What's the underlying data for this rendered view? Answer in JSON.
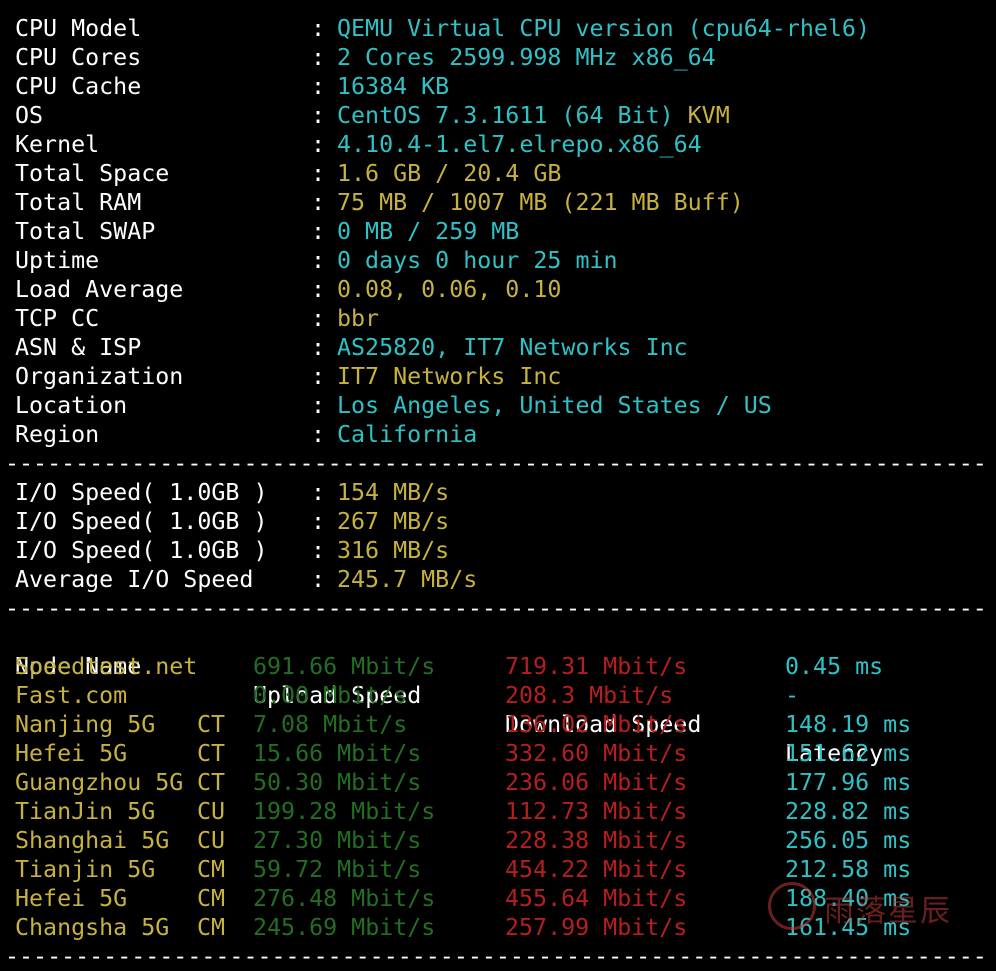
{
  "sysinfo": [
    {
      "key": "CPU Model",
      "value": "QEMU Virtual CPU version (cpu64-rhel6)",
      "value_tail": "",
      "color": "cy"
    },
    {
      "key": "CPU Cores",
      "value": "2 Cores 2599.998 MHz x86_64",
      "value_tail": "",
      "color": "cy"
    },
    {
      "key": "CPU Cache",
      "value": "16384 KB",
      "value_tail": "",
      "color": "cy"
    },
    {
      "key": "OS",
      "value": "CentOS 7.3.1611 (64 Bit)",
      "value_tail": " KVM",
      "color": "cy"
    },
    {
      "key": "Kernel",
      "value": "4.10.4-1.el7.elrepo.x86_64",
      "value_tail": "",
      "color": "cy"
    },
    {
      "key": "Total Space",
      "value": "1.6 GB / 20.4 GB",
      "value_tail": "",
      "color": "yl"
    },
    {
      "key": "Total RAM",
      "value": "75 MB / 1007 MB (221 MB Buff)",
      "value_tail": "",
      "color": "yl"
    },
    {
      "key": "Total SWAP",
      "value": "0 MB / 259 MB",
      "value_tail": "",
      "color": "cy"
    },
    {
      "key": "Uptime",
      "value": "0 days 0 hour 25 min",
      "value_tail": "",
      "color": "cy"
    },
    {
      "key": "Load Average",
      "value": "0.08, 0.06, 0.10",
      "value_tail": "",
      "color": "yl"
    },
    {
      "key": "TCP CC",
      "value": "bbr",
      "value_tail": "",
      "color": "yl"
    },
    {
      "key": "ASN & ISP",
      "value": "AS25820, IT7 Networks Inc",
      "value_tail": "",
      "color": "cy"
    },
    {
      "key": "Organization",
      "value": "IT7 Networks Inc",
      "value_tail": "",
      "color": "yl"
    },
    {
      "key": "Location",
      "value": "Los Angeles, United States / US",
      "value_tail": "",
      "color": "cy"
    },
    {
      "key": "Region",
      "value": "California",
      "value_tail": "",
      "color": "cy"
    }
  ],
  "separator_char": ":",
  "dash_line": "------------------------------------------------------------------------",
  "io": [
    {
      "key": "I/O Speed( 1.0GB )",
      "value": "154 MB/s"
    },
    {
      "key": "I/O Speed( 1.0GB )",
      "value": "267 MB/s"
    },
    {
      "key": "I/O Speed( 1.0GB )",
      "value": "316 MB/s"
    },
    {
      "key": "Average I/O Speed",
      "value": "245.7 MB/s"
    }
  ],
  "speed_headers": {
    "node": "Node Name",
    "upload": "Upload Speed",
    "download": "Download Speed",
    "latency": "Latency"
  },
  "speed_rows": [
    {
      "node": "Speedtest.net",
      "tag": "",
      "upload": "691.66 Mbit/s",
      "download": "719.31 Mbit/s",
      "latency": "0.45 ms"
    },
    {
      "node": "Fast.com",
      "tag": "",
      "upload": "0.00 Mbit/s",
      "download": "208.3 Mbit/s",
      "latency": "-"
    },
    {
      "node": "Nanjing 5G",
      "tag": "CT",
      "upload": "7.08 Mbit/s",
      "download": "136.02 Mbit/s",
      "latency": "148.19 ms"
    },
    {
      "node": "Hefei 5G",
      "tag": "CT",
      "upload": "15.66 Mbit/s",
      "download": "332.60 Mbit/s",
      "latency": "151.62 ms"
    },
    {
      "node": "Guangzhou 5G",
      "tag": "CT",
      "upload": "50.30 Mbit/s",
      "download": "236.06 Mbit/s",
      "latency": "177.96 ms"
    },
    {
      "node": "TianJin 5G",
      "tag": "CU",
      "upload": "199.28 Mbit/s",
      "download": "112.73 Mbit/s",
      "latency": "228.82 ms"
    },
    {
      "node": "Shanghai 5G",
      "tag": "CU",
      "upload": "27.30 Mbit/s",
      "download": "228.38 Mbit/s",
      "latency": "256.05 ms"
    },
    {
      "node": "Tianjin 5G",
      "tag": "CM",
      "upload": "59.72 Mbit/s",
      "download": "454.22 Mbit/s",
      "latency": "212.58 ms"
    },
    {
      "node": "Hefei 5G",
      "tag": "CM",
      "upload": "276.48 Mbit/s",
      "download": "455.64 Mbit/s",
      "latency": "188.40 ms"
    },
    {
      "node": "Changsha 5G",
      "tag": "CM",
      "upload": "245.69 Mbit/s",
      "download": "257.99 Mbit/s",
      "latency": "161.45 ms"
    }
  ],
  "watermark": {
    "text": "雨落星辰"
  },
  "colors": {
    "background": "#000000",
    "key": "#ffffff",
    "cyan": "#2ec2c7",
    "yellow": "#c6b23d",
    "green": "#236e23",
    "red": "#b51f1f"
  }
}
